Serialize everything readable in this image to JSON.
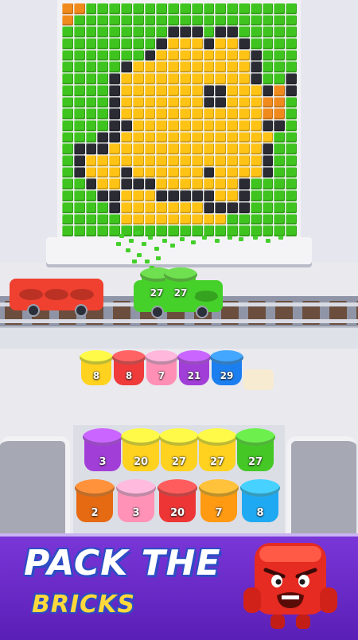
{
  "puzzle": {
    "palette": {
      "G": "#3fc41f",
      "Y": "#ffc316",
      "K": "#2a2b33",
      "O": "#f08a1c"
    },
    "rows": [
      "OOGGGGGGGGGGGGGGGGGG",
      "OGGGGGGGGGGGGGGGGGGG",
      "GGGGGGGGGKKKGKKGGGGG",
      "GGGGGGGGKYYYKYYKGGGG",
      "GGGGGGGKYYYYYYYYKGGG",
      "GGGGGKYYYYYYYYYYKGGG",
      "GGGGKYYYYYYYYYYYKGGK",
      "GGGGKYYYYYYYKKYYYKOK",
      "GGGGKYYYYYYYKKYYYOOG",
      "GGGGKYYYYYYYYYYYYOOG",
      "GGGGKKYYYYYYYYYYYKKG",
      "GGGKKYYYYYYYYYYYYYGG",
      "GKKKYYYYYYYYYYYYYKGG",
      "GKYYYYYYYYYYYYYYYKGG",
      "GKYYYKYYYYYYKYYYYKGG",
      "GGKYYKKKYYYYYYYKGGGG",
      "GGGKKYYYKKKKKYYKGGGG",
      "GGGGKYYYYYYYKKKKGGGG",
      "GGGGGYYYYYYYYYGGGGGG",
      "GGGGGGGGGGGGGGGGGGGG"
    ]
  },
  "carts": {
    "red": {
      "color": "#f0402f"
    },
    "green": {
      "color": "#45d12a",
      "cups": [
        27,
        27
      ]
    }
  },
  "queue": [
    {
      "count": "8",
      "color": "#ffd21f"
    },
    {
      "count": "8",
      "color": "#f03b3b"
    },
    {
      "count": "7",
      "color": "#ff8fb4"
    },
    {
      "count": "21",
      "color": "#a23ed8"
    },
    {
      "count": "29",
      "color": "#1c7ff0"
    }
  ],
  "tray_top": [
    {
      "count": "3",
      "color": "#a23ed8"
    },
    {
      "count": "20",
      "color": "#ffd21f"
    },
    {
      "count": "27",
      "color": "#ffd21f"
    },
    {
      "count": "27",
      "color": "#ffd21f"
    },
    {
      "count": "27",
      "color": "#45c826"
    }
  ],
  "tray_bottom": [
    {
      "count": "2",
      "color": "#e66a12"
    },
    {
      "count": "3",
      "color": "#ff92b6"
    },
    {
      "count": "20",
      "color": "#ee3535"
    },
    {
      "count": "7",
      "color": "#ff9a12"
    },
    {
      "count": "8",
      "color": "#1fa9f3"
    }
  ],
  "banner": {
    "line1": "PACK THE",
    "line2": "BRICKS"
  }
}
